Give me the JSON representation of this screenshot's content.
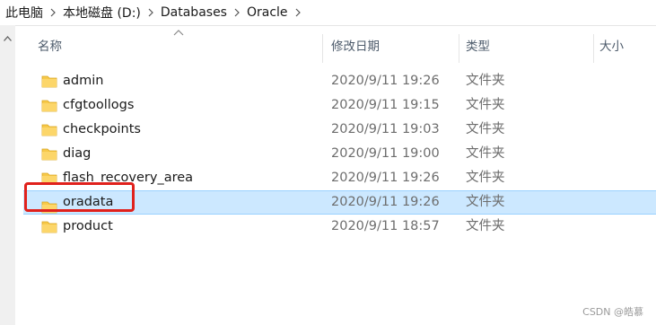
{
  "breadcrumb": [
    "此电脑",
    "本地磁盘 (D:)",
    "Databases",
    "Oracle"
  ],
  "columns": {
    "name": "名称",
    "modified": "修改日期",
    "type": "类型",
    "size": "大小"
  },
  "files": [
    {
      "name": "admin",
      "modified": "2020/9/11 19:26",
      "type": "文件夹"
    },
    {
      "name": "cfgtoollogs",
      "modified": "2020/9/11 19:15",
      "type": "文件夹"
    },
    {
      "name": "checkpoints",
      "modified": "2020/9/11 19:03",
      "type": "文件夹"
    },
    {
      "name": "diag",
      "modified": "2020/9/11 19:00",
      "type": "文件夹"
    },
    {
      "name": "flash_recovery_area",
      "modified": "2020/9/11 19:26",
      "type": "文件夹"
    },
    {
      "name": "oradata",
      "modified": "2020/9/11 19:26",
      "type": "文件夹",
      "selected": true
    },
    {
      "name": "product",
      "modified": "2020/9/11 18:57",
      "type": "文件夹"
    }
  ],
  "colors": {
    "selection": "#cce8ff",
    "highlight": "#e0211c",
    "folder": "#f7c94a"
  },
  "icons": {
    "folder": "folder-icon",
    "separator": "chevron-right-icon",
    "sort": "sort-ascending-icon",
    "scroll": "scroll-up-icon"
  },
  "watermark": "CSDN @皓慕"
}
